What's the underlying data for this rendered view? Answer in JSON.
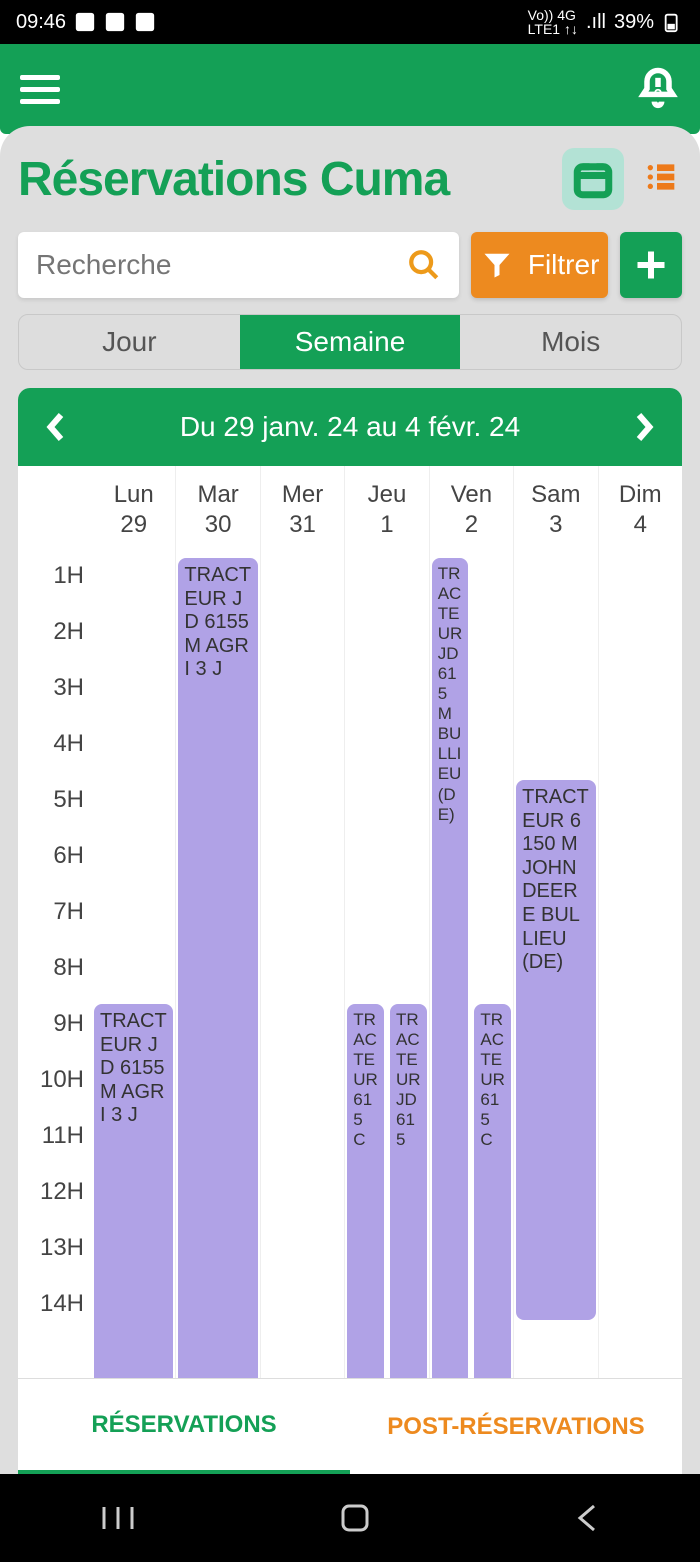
{
  "status": {
    "time": "09:46",
    "battery": "39%"
  },
  "page": {
    "title": "Réservations Cuma"
  },
  "search": {
    "placeholder": "Recherche"
  },
  "filter": {
    "label": "Filtrer"
  },
  "view": {
    "day": "Jour",
    "week": "Semaine",
    "month": "Mois",
    "range": "Du 29 janv. 24 au 4 févr. 24"
  },
  "days": [
    {
      "name": "Lun",
      "num": "29"
    },
    {
      "name": "Mar",
      "num": "30"
    },
    {
      "name": "Mer",
      "num": "31"
    },
    {
      "name": "Jeu",
      "num": "1"
    },
    {
      "name": "Ven",
      "num": "2"
    },
    {
      "name": "Sam",
      "num": "3"
    },
    {
      "name": "Dim",
      "num": "4"
    }
  ],
  "hours": [
    "1H",
    "2H",
    "3H",
    "4H",
    "5H",
    "6H",
    "7H",
    "8H",
    "9H",
    "10H",
    "11H",
    "12H",
    "13H",
    "14H"
  ],
  "events": {
    "lun": "TRACTEUR JD 6155 M AGRI 3 J",
    "mar": "TRACTEUR JD 6155 M AGRI 3 J",
    "jeu1": "TRACTEUR 615 C",
    "jeu2": "TRACTEUR JD 615",
    "ven1": "TRACTEUR JD 615 M BULLIEU (DE)",
    "ven2": "TRACTEUR 615 C",
    "sam": "TRACTEUR 6150 M JOHN DEERE BULLIEU (DE)"
  },
  "tabs": {
    "res": "RÉSERVATIONS",
    "post": "POST-RÉSERVATIONS"
  }
}
